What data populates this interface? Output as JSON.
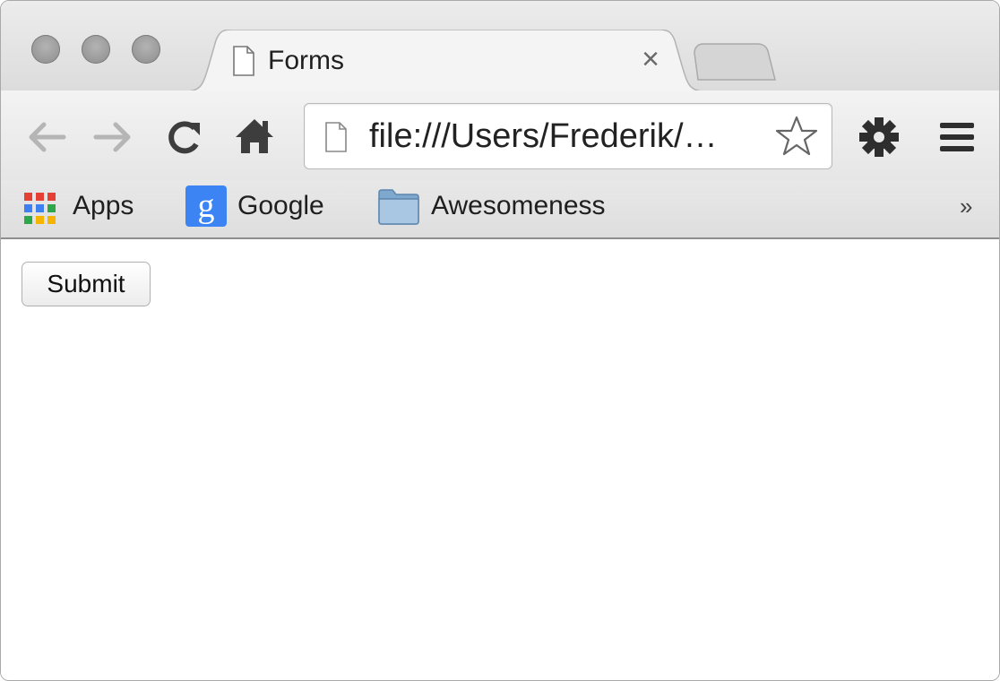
{
  "tab": {
    "title": "Forms",
    "close_label": "×"
  },
  "toolbar": {
    "url": "file:///Users/Frederik/…",
    "icons": [
      "back-arrow-icon",
      "forward-arrow-icon",
      "reload-icon",
      "home-icon",
      "page-icon",
      "star-icon",
      "gear-icon",
      "menu-icon"
    ]
  },
  "bookmarks": {
    "items": [
      {
        "label": "Apps",
        "icon": "apps-grid-icon"
      },
      {
        "label": "Google",
        "icon": "google-icon"
      },
      {
        "label": "Awesomeness",
        "icon": "folder-icon"
      }
    ],
    "more_label": "»"
  },
  "content": {
    "submit_label": "Submit"
  },
  "colors": {
    "accent_google": "#3c84f4",
    "chrome_bg": "#e6e6e6",
    "page_bg": "#ffffff"
  }
}
